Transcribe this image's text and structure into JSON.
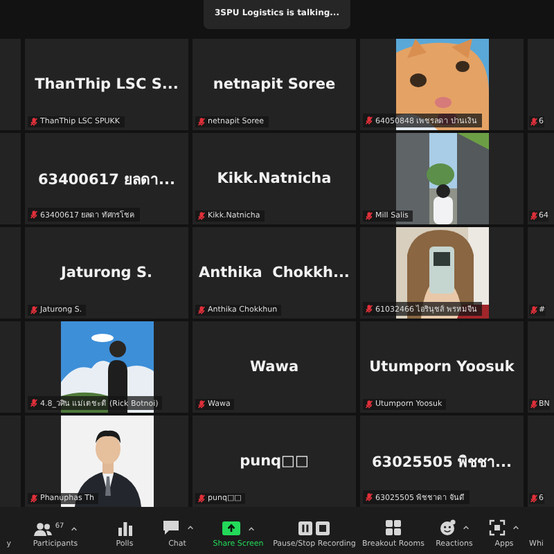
{
  "talking_banner": "3SPU Logistics is talking...",
  "rows": [
    {
      "tiles": [
        {
          "kind": "name",
          "display_name": "ThanThip LSC S...",
          "label": "ThanThip LSC SPUKK",
          "muted": true
        },
        {
          "kind": "name",
          "display_name": "netnapit Soree",
          "label": "netnapit Soree",
          "muted": true
        },
        {
          "kind": "picture",
          "label": "64050848 เพชรลดา ปานเงิน",
          "muted": true
        }
      ],
      "edge_tile": {
        "label": "6",
        "muted": true
      }
    },
    {
      "tiles": [
        {
          "kind": "name",
          "display_name": "63400617 ยลดา...",
          "label": "63400617 ยลดา ทัศกรโชค",
          "muted": true
        },
        {
          "kind": "name",
          "display_name": "Kikk.Natnicha",
          "label": "Kikk.Natnicha",
          "muted": true
        },
        {
          "kind": "picture",
          "label": "Mill Salis",
          "muted": true
        }
      ],
      "edge_tile": {
        "label": "64",
        "muted": true
      }
    },
    {
      "tiles": [
        {
          "kind": "name",
          "display_name": "Jaturong S.",
          "label": "Jaturong S.",
          "muted": true
        },
        {
          "kind": "name",
          "display_name": "Anthika  Chokkh...",
          "label": "Anthika Chokkhun",
          "muted": true
        },
        {
          "kind": "picture",
          "label": "61032466 ไอรินุชส์ พรหมจีน",
          "muted": true
        }
      ],
      "edge_tile": {
        "label": "#",
        "muted": true
      }
    },
    {
      "tiles": [
        {
          "kind": "picture",
          "label": "4.8_วศิน แม่เตชะติ (Rick Botnoi)",
          "muted": true
        },
        {
          "kind": "name",
          "display_name": "Wawa",
          "label": "Wawa",
          "muted": true
        },
        {
          "kind": "name",
          "display_name": "Utumporn Yoosuk",
          "label": "Utumporn Yoosuk",
          "muted": true
        }
      ],
      "edge_tile": {
        "label": "BN",
        "muted": true
      }
    },
    {
      "tiles": [
        {
          "kind": "picture",
          "label": "Phanuphas Th",
          "muted": true
        },
        {
          "kind": "name",
          "display_name": "punq□□",
          "label": "punq□□",
          "muted": true
        },
        {
          "kind": "name",
          "display_name": "63025505 พิชชา...",
          "label": "63025505 พิชชาดา จันดี",
          "muted": true
        }
      ],
      "edge_tile": {
        "label": "6",
        "muted": true
      }
    }
  ],
  "toolbar": [
    {
      "kind": "cut",
      "label": "y",
      "caret": false,
      "highlighted": false
    },
    {
      "kind": "participants",
      "label": "Participants",
      "count": "67",
      "caret": true,
      "highlighted": false
    },
    {
      "kind": "polls",
      "label": "Polls",
      "caret": false,
      "highlighted": false
    },
    {
      "kind": "chat",
      "label": "Chat",
      "caret": true,
      "highlighted": false
    },
    {
      "kind": "share",
      "label": "Share Screen",
      "caret": true,
      "highlighted": true
    },
    {
      "kind": "recording",
      "label": "Pause/Stop Recording",
      "caret": false,
      "highlighted": false
    },
    {
      "kind": "breakout",
      "label": "Breakout Rooms",
      "caret": false,
      "highlighted": false
    },
    {
      "kind": "reactions",
      "label": "Reactions",
      "caret": true,
      "highlighted": false
    },
    {
      "kind": "apps",
      "label": "Apps",
      "caret": true,
      "highlighted": false
    },
    {
      "kind": "cut",
      "label": "Whi",
      "caret": false,
      "highlighted": false
    }
  ]
}
